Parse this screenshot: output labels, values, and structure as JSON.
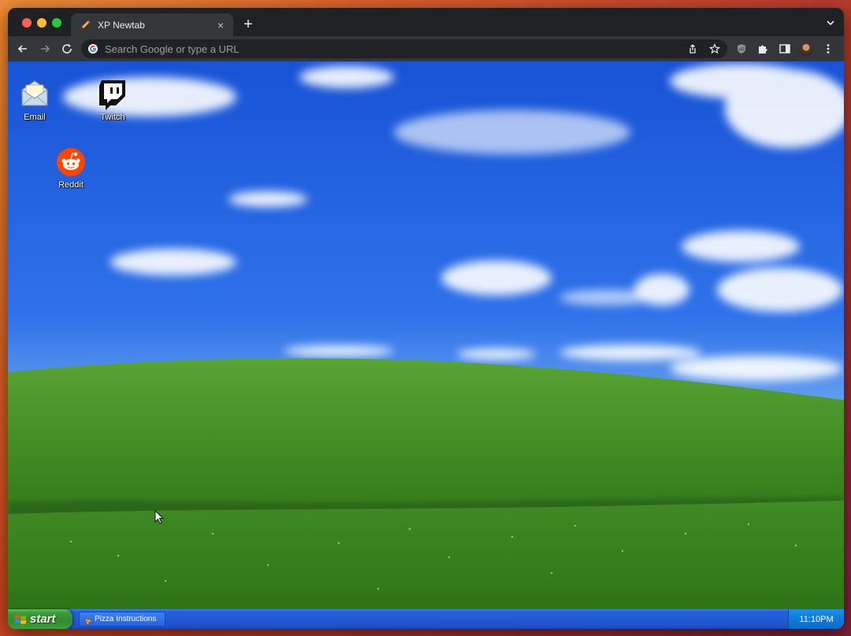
{
  "browser": {
    "tab": {
      "title": "XP Newtab",
      "favicon": "pencil-icon",
      "close": "×"
    },
    "new_tab": "+",
    "omnibox": {
      "placeholder": "Search Google or type a URL",
      "value": ""
    },
    "icons": [
      "back-arrow-icon",
      "forward-arrow-icon",
      "reload-icon",
      "google-icon",
      "share-icon",
      "bookmark-star-icon",
      "ublock-icon",
      "extensions-puzzle-icon",
      "side-panel-icon",
      "profile-avatar",
      "menu-kebab-icon",
      "tab-search-chevron-icon"
    ]
  },
  "desktop": {
    "icons": [
      {
        "label": "Email",
        "icon": "email-envelope-icon"
      },
      {
        "label": "Twitch",
        "icon": "twitch-icon"
      },
      {
        "label": "Reddit",
        "icon": "reddit-icon"
      }
    ]
  },
  "taskbar": {
    "start_label": "start",
    "items": [
      {
        "label": "Pizza Instructions",
        "icon": "pizza-icon"
      }
    ],
    "clock": "11:10PM"
  },
  "colors": {
    "sky": "#2c6fea",
    "grass": "#4b9a2a",
    "taskbar": "#245edb",
    "start": "#3c9a3a",
    "reddit": "#ff4500"
  }
}
